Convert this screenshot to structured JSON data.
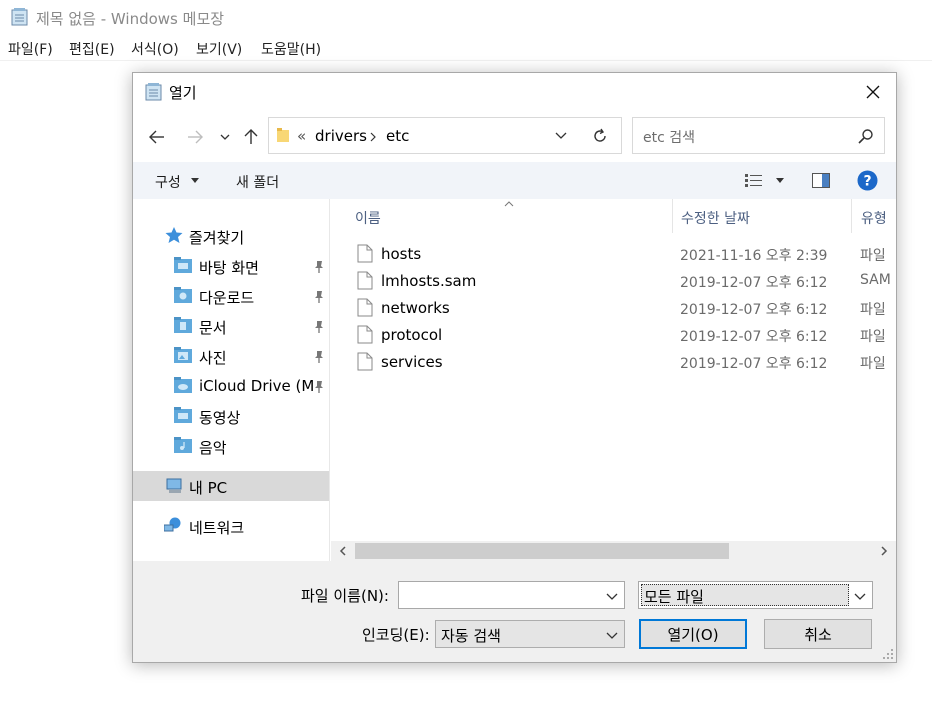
{
  "notepad": {
    "title": "제목 없음 - Windows 메모장",
    "menu": [
      "파일(F)",
      "편집(E)",
      "서식(O)",
      "보기(V)",
      "도움말(H)"
    ]
  },
  "dialog": {
    "title": "열기",
    "breadcrumb": {
      "chevron": "«",
      "items": [
        "drivers",
        "etc"
      ]
    },
    "search": {
      "placeholder": "etc 검색"
    },
    "toolbar": {
      "organize": "구성",
      "new_folder": "새 폴더"
    },
    "nav": {
      "quick_access": "즐겨찾기",
      "items": [
        {
          "label": "바탕 화면",
          "icon": "desktop-folder-icon",
          "pinned": true
        },
        {
          "label": "다운로드",
          "icon": "downloads-folder-icon",
          "pinned": true
        },
        {
          "label": "문서",
          "icon": "documents-folder-icon",
          "pinned": true
        },
        {
          "label": "사진",
          "icon": "pictures-folder-icon",
          "pinned": true
        },
        {
          "label": "iCloud Drive (M",
          "icon": "icloud-folder-icon",
          "pinned": true
        },
        {
          "label": "동영상",
          "icon": "videos-folder-icon",
          "pinned": false
        },
        {
          "label": "음악",
          "icon": "music-folder-icon",
          "pinned": false
        }
      ],
      "this_pc": "내 PC",
      "network": "네트워크"
    },
    "columns": {
      "name": "이름",
      "modified": "수정한 날짜",
      "type": "유형"
    },
    "files": [
      {
        "name": "hosts",
        "modified": "2021-11-16 오후 2:39",
        "type": "파일"
      },
      {
        "name": "lmhosts.sam",
        "modified": "2019-12-07 오후 6:12",
        "type": "SAM"
      },
      {
        "name": "networks",
        "modified": "2019-12-07 오후 6:12",
        "type": "파일"
      },
      {
        "name": "protocol",
        "modified": "2019-12-07 오후 6:12",
        "type": "파일"
      },
      {
        "name": "services",
        "modified": "2019-12-07 오후 6:12",
        "type": "파일"
      }
    ],
    "filename": {
      "label": "파일 이름(N):",
      "value": ""
    },
    "filter": {
      "value": "모든 파일"
    },
    "encoding": {
      "label": "인코딩(E):",
      "value": "자동 검색"
    },
    "buttons": {
      "open": "열기(O)",
      "cancel": "취소"
    }
  },
  "colors": {
    "accent": "#0078d7",
    "folder_blue": "#5fa9dc",
    "toolbar_bg": "#f1f4f9",
    "selected": "#d9d9d9"
  }
}
